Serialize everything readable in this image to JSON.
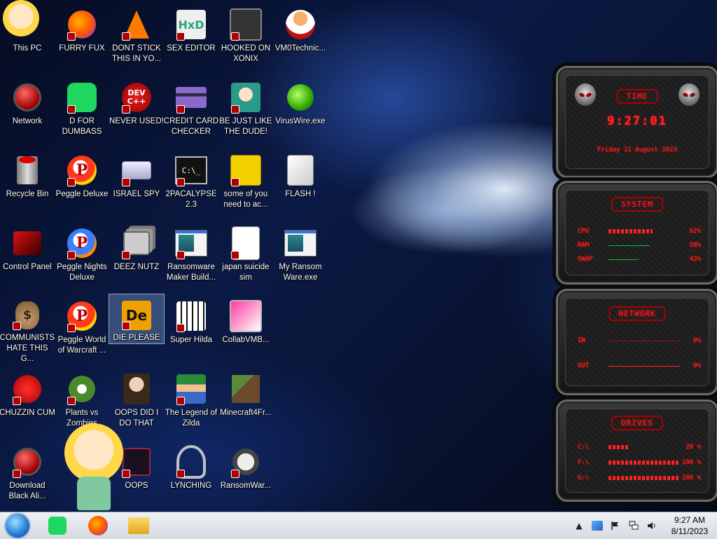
{
  "icons": [
    {
      "label": "This PC"
    },
    {
      "label": "FURRY FUX"
    },
    {
      "label": "DONT STICK THIS IN YO..."
    },
    {
      "label": "SEX EDITOR"
    },
    {
      "label": "HOOKED ON XONIX"
    },
    {
      "label": "VM0Technic..."
    },
    {
      "label": "Network"
    },
    {
      "label": "D FOR DUMBASS"
    },
    {
      "label": "NEVER USED!"
    },
    {
      "label": "CREDIT CARD CHECKER"
    },
    {
      "label": "BE JUST LIKE THE DUDE!"
    },
    {
      "label": "VirusWire.exe"
    },
    {
      "label": "Recycle Bin"
    },
    {
      "label": "Peggle Deluxe"
    },
    {
      "label": "ISRAEL SPY"
    },
    {
      "label": "2PACALYPSE 2.3"
    },
    {
      "label": "some of you need to ac..."
    },
    {
      "label": "FLASH !"
    },
    {
      "label": "Control Panel"
    },
    {
      "label": "Peggle Nights Deluxe"
    },
    {
      "label": "DEEZ NUTZ"
    },
    {
      "label": "Ransomware Maker Build..."
    },
    {
      "label": "japan suicide sim"
    },
    {
      "label": "My Ransom Ware.exe"
    },
    {
      "label": "COMMUNISTS HATE THIS G..."
    },
    {
      "label": "Peggle World of Warcraft ..."
    },
    {
      "label": "DIE PLEASE"
    },
    {
      "label": "Super Hilda"
    },
    {
      "label": "CollabVMB..."
    },
    {
      "label": "CHUZZIN CUM"
    },
    {
      "label": "Plants vs Zombies"
    },
    {
      "label": "OOPS DID I DO THAT"
    },
    {
      "label": "The Legend of Zilda"
    },
    {
      "label": "Minecraft4Fr..."
    },
    {
      "label": "Download Black Ali..."
    },
    {
      "label": "OOPS"
    },
    {
      "label": "LYNCHING"
    },
    {
      "label": "RansomWar..."
    }
  ],
  "icon_glyphs": {
    "dev": "DEV",
    "dev_sub": "C++",
    "term": "C:\\_",
    "bag": "$",
    "peggle": "P",
    "de": "De",
    "hxd": "HxD"
  },
  "widget": {
    "time": {
      "title": "TIME",
      "clock": "9:27:01",
      "date": "Friday 11 August 2023"
    },
    "system": {
      "title": "SYSTEM",
      "rows": [
        {
          "key": "CPU",
          "value": "62%",
          "fill": 0.62
        },
        {
          "key": "RAM",
          "value": "58%",
          "fill": 0.58
        },
        {
          "key": "SWAP",
          "value": "42%",
          "fill": 0.42
        }
      ]
    },
    "network": {
      "title": "NETWORK",
      "rows": [
        {
          "key": "IN",
          "value": "0%"
        },
        {
          "key": "OUT",
          "value": "0%"
        }
      ]
    },
    "drives": {
      "title": "DRIVES",
      "rows": [
        {
          "key": "C:\\",
          "value": "28 %",
          "fill": 0.28
        },
        {
          "key": "F:\\",
          "value": "100 %",
          "fill": 1.0
        },
        {
          "key": "G:\\",
          "value": "100 %",
          "fill": 1.0
        }
      ]
    }
  },
  "taskbar": {
    "clock_time": "9:27 AM",
    "clock_date": "8/11/2023",
    "tray_chevron": "▲"
  },
  "colors": {
    "widget_red": "#ff2020",
    "taskbar": "#e4e8ee",
    "accent": "#1e7ad8"
  }
}
